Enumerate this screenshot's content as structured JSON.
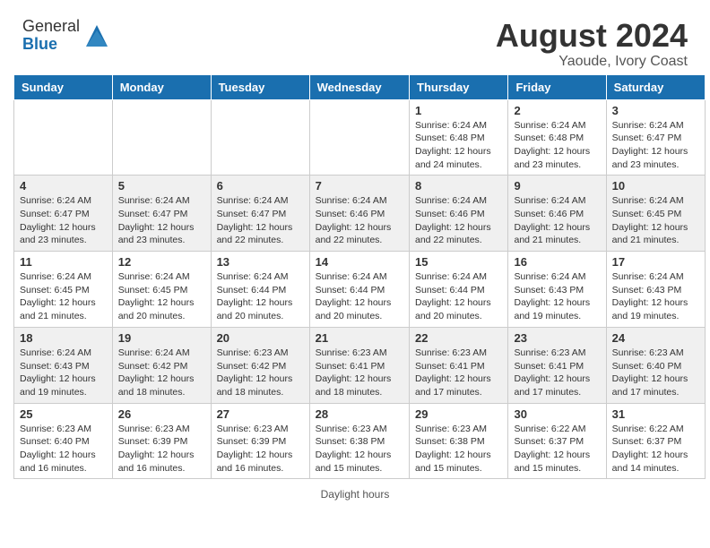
{
  "header": {
    "logo_general": "General",
    "logo_blue": "Blue",
    "month_year": "August 2024",
    "location": "Yaoude, Ivory Coast"
  },
  "days_of_week": [
    "Sunday",
    "Monday",
    "Tuesday",
    "Wednesday",
    "Thursday",
    "Friday",
    "Saturday"
  ],
  "weeks": [
    [
      {
        "day": "",
        "info": ""
      },
      {
        "day": "",
        "info": ""
      },
      {
        "day": "",
        "info": ""
      },
      {
        "day": "",
        "info": ""
      },
      {
        "day": "1",
        "info": "Sunrise: 6:24 AM\nSunset: 6:48 PM\nDaylight: 12 hours and 24 minutes."
      },
      {
        "day": "2",
        "info": "Sunrise: 6:24 AM\nSunset: 6:48 PM\nDaylight: 12 hours and 23 minutes."
      },
      {
        "day": "3",
        "info": "Sunrise: 6:24 AM\nSunset: 6:47 PM\nDaylight: 12 hours and 23 minutes."
      }
    ],
    [
      {
        "day": "4",
        "info": "Sunrise: 6:24 AM\nSunset: 6:47 PM\nDaylight: 12 hours and 23 minutes."
      },
      {
        "day": "5",
        "info": "Sunrise: 6:24 AM\nSunset: 6:47 PM\nDaylight: 12 hours and 23 minutes."
      },
      {
        "day": "6",
        "info": "Sunrise: 6:24 AM\nSunset: 6:47 PM\nDaylight: 12 hours and 22 minutes."
      },
      {
        "day": "7",
        "info": "Sunrise: 6:24 AM\nSunset: 6:46 PM\nDaylight: 12 hours and 22 minutes."
      },
      {
        "day": "8",
        "info": "Sunrise: 6:24 AM\nSunset: 6:46 PM\nDaylight: 12 hours and 22 minutes."
      },
      {
        "day": "9",
        "info": "Sunrise: 6:24 AM\nSunset: 6:46 PM\nDaylight: 12 hours and 21 minutes."
      },
      {
        "day": "10",
        "info": "Sunrise: 6:24 AM\nSunset: 6:45 PM\nDaylight: 12 hours and 21 minutes."
      }
    ],
    [
      {
        "day": "11",
        "info": "Sunrise: 6:24 AM\nSunset: 6:45 PM\nDaylight: 12 hours and 21 minutes."
      },
      {
        "day": "12",
        "info": "Sunrise: 6:24 AM\nSunset: 6:45 PM\nDaylight: 12 hours and 20 minutes."
      },
      {
        "day": "13",
        "info": "Sunrise: 6:24 AM\nSunset: 6:44 PM\nDaylight: 12 hours and 20 minutes."
      },
      {
        "day": "14",
        "info": "Sunrise: 6:24 AM\nSunset: 6:44 PM\nDaylight: 12 hours and 20 minutes."
      },
      {
        "day": "15",
        "info": "Sunrise: 6:24 AM\nSunset: 6:44 PM\nDaylight: 12 hours and 20 minutes."
      },
      {
        "day": "16",
        "info": "Sunrise: 6:24 AM\nSunset: 6:43 PM\nDaylight: 12 hours and 19 minutes."
      },
      {
        "day": "17",
        "info": "Sunrise: 6:24 AM\nSunset: 6:43 PM\nDaylight: 12 hours and 19 minutes."
      }
    ],
    [
      {
        "day": "18",
        "info": "Sunrise: 6:24 AM\nSunset: 6:43 PM\nDaylight: 12 hours and 19 minutes."
      },
      {
        "day": "19",
        "info": "Sunrise: 6:24 AM\nSunset: 6:42 PM\nDaylight: 12 hours and 18 minutes."
      },
      {
        "day": "20",
        "info": "Sunrise: 6:23 AM\nSunset: 6:42 PM\nDaylight: 12 hours and 18 minutes."
      },
      {
        "day": "21",
        "info": "Sunrise: 6:23 AM\nSunset: 6:41 PM\nDaylight: 12 hours and 18 minutes."
      },
      {
        "day": "22",
        "info": "Sunrise: 6:23 AM\nSunset: 6:41 PM\nDaylight: 12 hours and 17 minutes."
      },
      {
        "day": "23",
        "info": "Sunrise: 6:23 AM\nSunset: 6:41 PM\nDaylight: 12 hours and 17 minutes."
      },
      {
        "day": "24",
        "info": "Sunrise: 6:23 AM\nSunset: 6:40 PM\nDaylight: 12 hours and 17 minutes."
      }
    ],
    [
      {
        "day": "25",
        "info": "Sunrise: 6:23 AM\nSunset: 6:40 PM\nDaylight: 12 hours and 16 minutes."
      },
      {
        "day": "26",
        "info": "Sunrise: 6:23 AM\nSunset: 6:39 PM\nDaylight: 12 hours and 16 minutes."
      },
      {
        "day": "27",
        "info": "Sunrise: 6:23 AM\nSunset: 6:39 PM\nDaylight: 12 hours and 16 minutes."
      },
      {
        "day": "28",
        "info": "Sunrise: 6:23 AM\nSunset: 6:38 PM\nDaylight: 12 hours and 15 minutes."
      },
      {
        "day": "29",
        "info": "Sunrise: 6:23 AM\nSunset: 6:38 PM\nDaylight: 12 hours and 15 minutes."
      },
      {
        "day": "30",
        "info": "Sunrise: 6:22 AM\nSunset: 6:37 PM\nDaylight: 12 hours and 15 minutes."
      },
      {
        "day": "31",
        "info": "Sunrise: 6:22 AM\nSunset: 6:37 PM\nDaylight: 12 hours and 14 minutes."
      }
    ]
  ],
  "footer": {
    "note": "Daylight hours"
  }
}
